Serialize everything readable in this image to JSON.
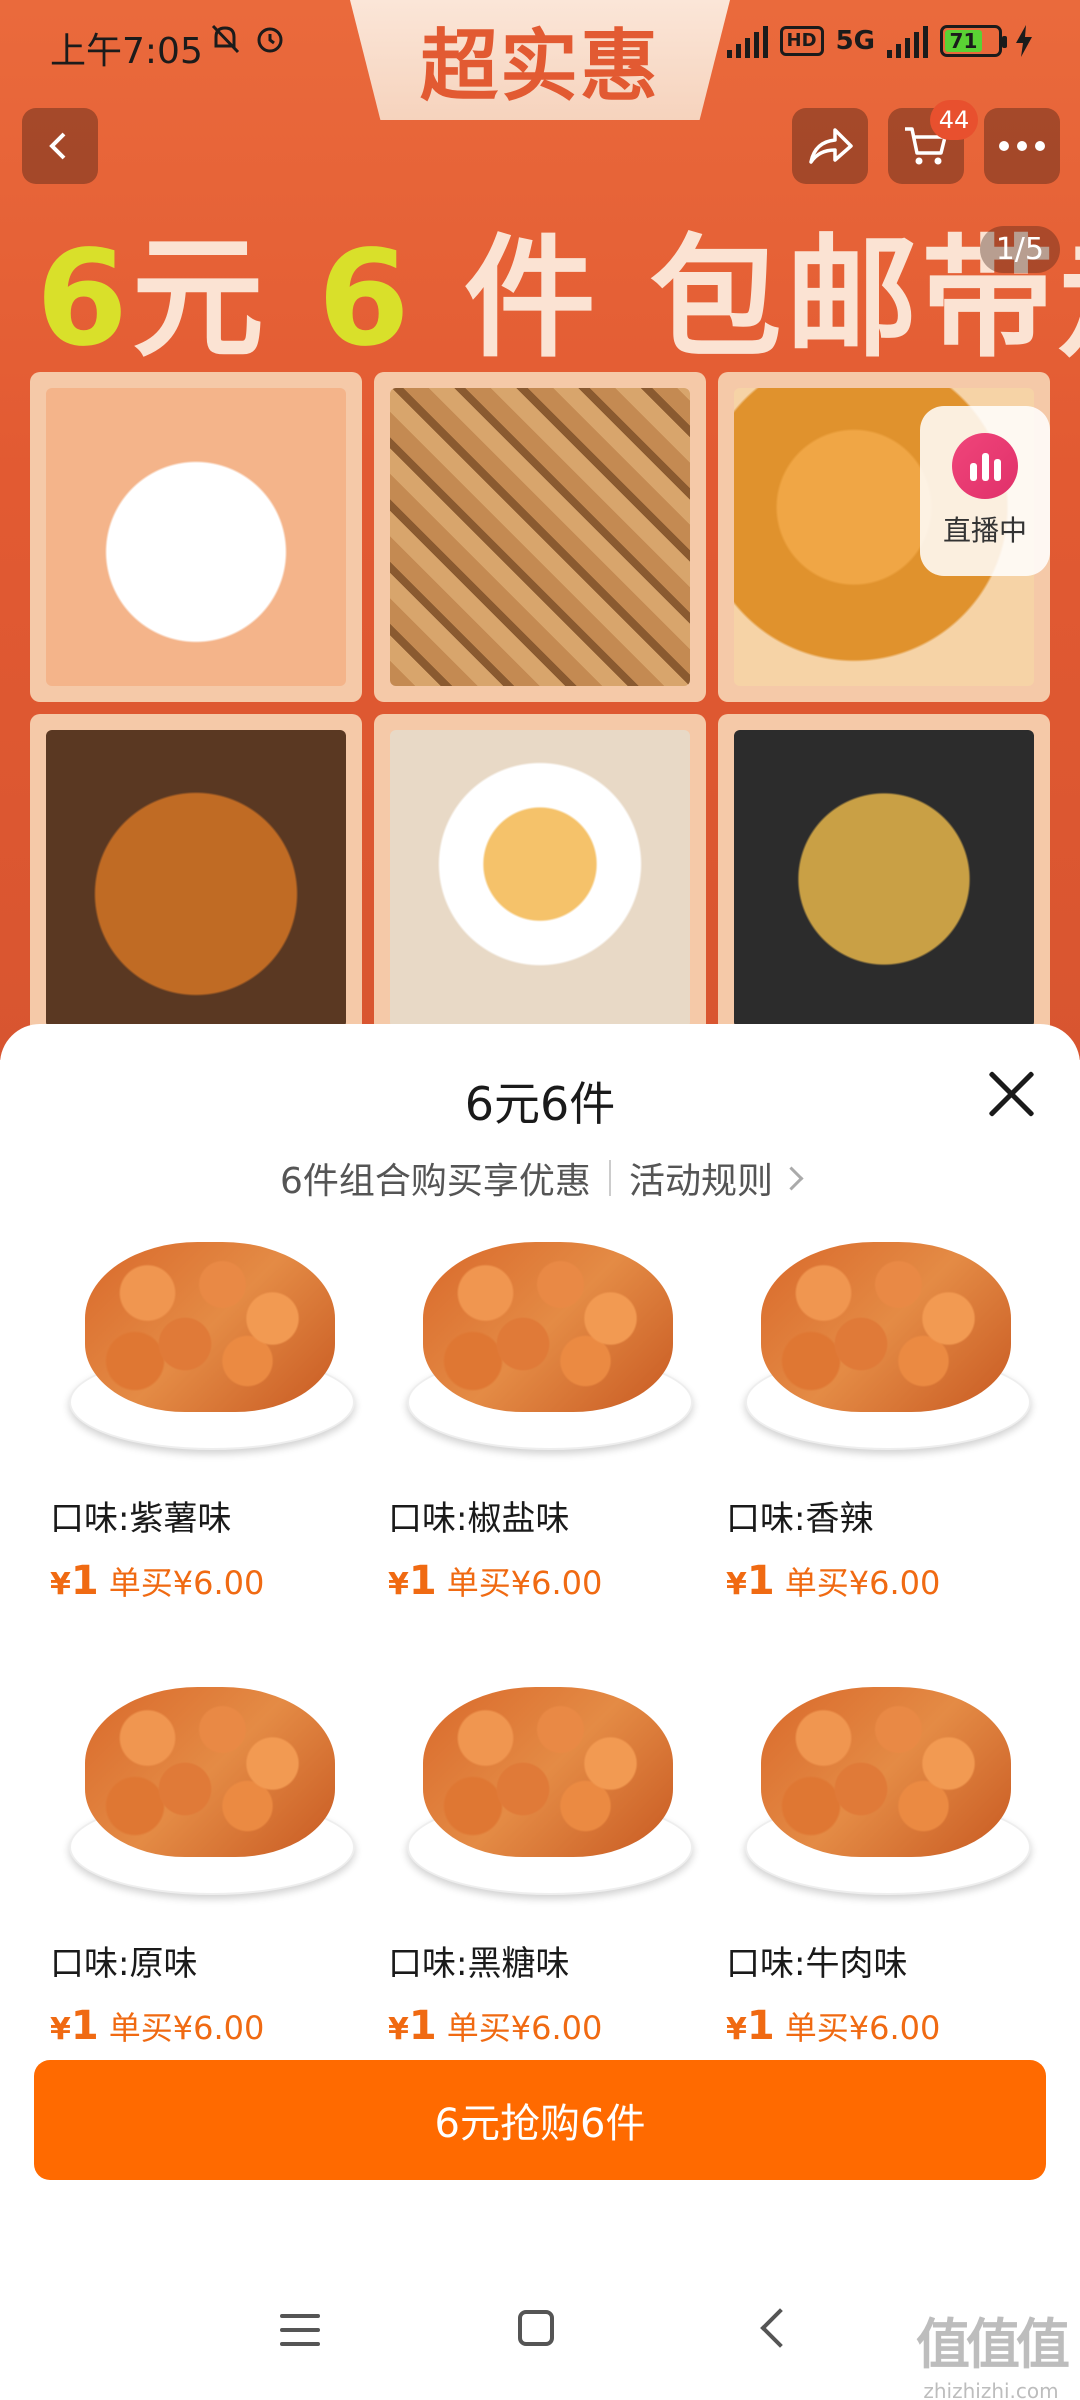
{
  "status_bar": {
    "time": "上午7:05",
    "network": "5G",
    "hd": "HD",
    "battery": "71"
  },
  "banner": {
    "promo_tab": "超实惠",
    "headline_part1": "6",
    "headline_part2": "元 ",
    "headline_part3": "6",
    "headline_part4": " 件 包邮带走",
    "page_indicator": "1/5",
    "cart_count": "44",
    "live_label": "直播中"
  },
  "sheet": {
    "title": "6元6件",
    "subtitle": "6件组合购买享优惠",
    "rules_link": "活动规则",
    "items": [
      {
        "name": "口味:紫薯味",
        "price": "1",
        "currency": "¥",
        "single_price": "单买¥6.00"
      },
      {
        "name": "口味:椒盐味",
        "price": "1",
        "currency": "¥",
        "single_price": "单买¥6.00"
      },
      {
        "name": "口味:香辣",
        "price": "1",
        "currency": "¥",
        "single_price": "单买¥6.00"
      },
      {
        "name": "口味:原味",
        "price": "1",
        "currency": "¥",
        "single_price": "单买¥6.00"
      },
      {
        "name": "口味:黑糖味",
        "price": "1",
        "currency": "¥",
        "single_price": "单买¥6.00"
      },
      {
        "name": "口味:牛肉味",
        "price": "1",
        "currency": "¥",
        "single_price": "单买¥6.00"
      }
    ],
    "cta_label": "6元抢购6件"
  },
  "watermark": {
    "logo": "值值值",
    "text": "zhizhizhi.com"
  },
  "colors": {
    "accent": "#ff6a00",
    "price": "#f06a12",
    "banner": "#e25a32"
  }
}
